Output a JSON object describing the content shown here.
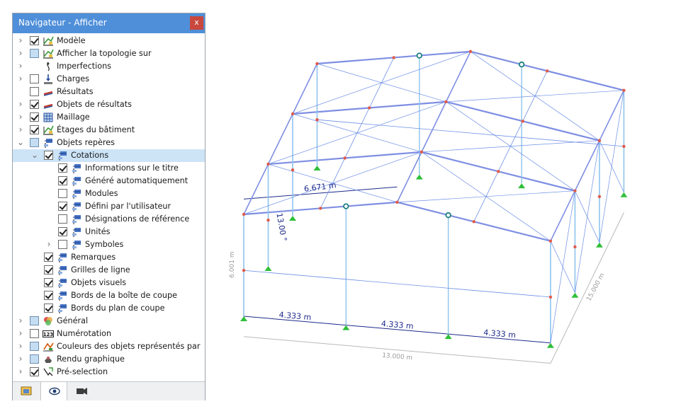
{
  "window": {
    "title": "Navigateur - Afficher",
    "close_glyph": "x"
  },
  "tree": [
    {
      "label": "Modèle",
      "level": 0,
      "expander": "collapsed",
      "check": "checked",
      "icon": "model-icon"
    },
    {
      "label": "Afficher la topologie sur",
      "level": 0,
      "expander": "collapsed",
      "check": "partial",
      "icon": "topology-icon"
    },
    {
      "label": "Imperfections",
      "level": 0,
      "expander": "collapsed",
      "check": "none",
      "icon": "imperfection-icon"
    },
    {
      "label": "Charges",
      "level": 0,
      "expander": "collapsed",
      "check": "unchecked",
      "icon": "load-icon"
    },
    {
      "label": "Résultats",
      "level": 0,
      "expander": "none",
      "check": "unchecked",
      "icon": "results-icon"
    },
    {
      "label": "Objets de résultats",
      "level": 0,
      "expander": "collapsed",
      "check": "checked",
      "icon": "result-objects-icon"
    },
    {
      "label": "Maillage",
      "level": 0,
      "expander": "collapsed",
      "check": "checked",
      "icon": "mesh-icon"
    },
    {
      "label": "Étages du bâtiment",
      "level": 0,
      "expander": "collapsed",
      "check": "checked",
      "icon": "building-stories-icon"
    },
    {
      "label": "Objets repères",
      "level": 0,
      "expander": "expanded",
      "check": "partial",
      "icon": "guide-objects-icon"
    },
    {
      "label": "Cotations",
      "level": 1,
      "expander": "expanded",
      "check": "checked",
      "icon": "dimension-icon",
      "selected": true
    },
    {
      "label": "Informations sur le titre",
      "level": 2,
      "expander": "none",
      "check": "checked",
      "icon": "dimension-icon"
    },
    {
      "label": "Généré automatiquement",
      "level": 2,
      "expander": "none",
      "check": "checked",
      "icon": "dimension-icon"
    },
    {
      "label": "Modules",
      "level": 2,
      "expander": "none",
      "check": "unchecked",
      "icon": "dimension-icon"
    },
    {
      "label": "Défini par l'utilisateur",
      "level": 2,
      "expander": "none",
      "check": "checked",
      "icon": "dimension-icon"
    },
    {
      "label": "Désignations de référence",
      "level": 2,
      "expander": "none",
      "check": "unchecked",
      "icon": "dimension-icon"
    },
    {
      "label": "Unités",
      "level": 2,
      "expander": "none",
      "check": "checked",
      "icon": "dimension-icon"
    },
    {
      "label": "Symboles",
      "level": 2,
      "expander": "collapsed",
      "check": "unchecked",
      "icon": "dimension-icon"
    },
    {
      "label": "Remarques",
      "level": 1,
      "expander": "none",
      "check": "checked",
      "icon": "guide-objects-icon"
    },
    {
      "label": "Grilles de ligne",
      "level": 1,
      "expander": "none",
      "check": "checked",
      "icon": "guide-objects-icon"
    },
    {
      "label": "Objets visuels",
      "level": 1,
      "expander": "none",
      "check": "checked",
      "icon": "guide-objects-icon"
    },
    {
      "label": "Bords de la boîte de coupe",
      "level": 1,
      "expander": "none",
      "check": "checked",
      "icon": "guide-objects-icon"
    },
    {
      "label": "Bords du plan de coupe",
      "level": 1,
      "expander": "none",
      "check": "checked",
      "icon": "guide-objects-icon"
    },
    {
      "label": "Général",
      "level": 0,
      "expander": "collapsed",
      "check": "partial",
      "icon": "general-icon"
    },
    {
      "label": "Numérotation",
      "level": 0,
      "expander": "collapsed",
      "check": "unchecked",
      "icon": "numbering-icon"
    },
    {
      "label": "Couleurs des objets représentés par",
      "level": 0,
      "expander": "collapsed",
      "check": "partial",
      "icon": "colors-icon"
    },
    {
      "label": "Rendu graphique",
      "level": 0,
      "expander": "collapsed",
      "check": "partial",
      "icon": "rendering-icon"
    },
    {
      "label": "Pré-selection",
      "level": 0,
      "expander": "collapsed",
      "check": "checked",
      "icon": "preselection-icon"
    }
  ],
  "bottom_tabs": [
    {
      "name": "data-tab",
      "icon": "data-navigator-icon",
      "active": false
    },
    {
      "name": "display-tab",
      "icon": "eye-icon",
      "active": true
    },
    {
      "name": "views-tab",
      "icon": "camera-icon",
      "active": false
    }
  ],
  "model": {
    "dimensions": {
      "span_top": "6.671 m",
      "slope": "13.00 °",
      "height": "6.001 m",
      "bay": "4.333 m",
      "total_length": "13.000 m",
      "depth": "15.000 m"
    },
    "colors": {
      "member": "#7e8fe3",
      "brace": "#6d8fe6",
      "column": "#8fc3ee",
      "node": "#e05a4a",
      "support": "#2fbf3a",
      "dim_text": "#1d2a8c",
      "dim_line": "#b9b9b9"
    }
  }
}
